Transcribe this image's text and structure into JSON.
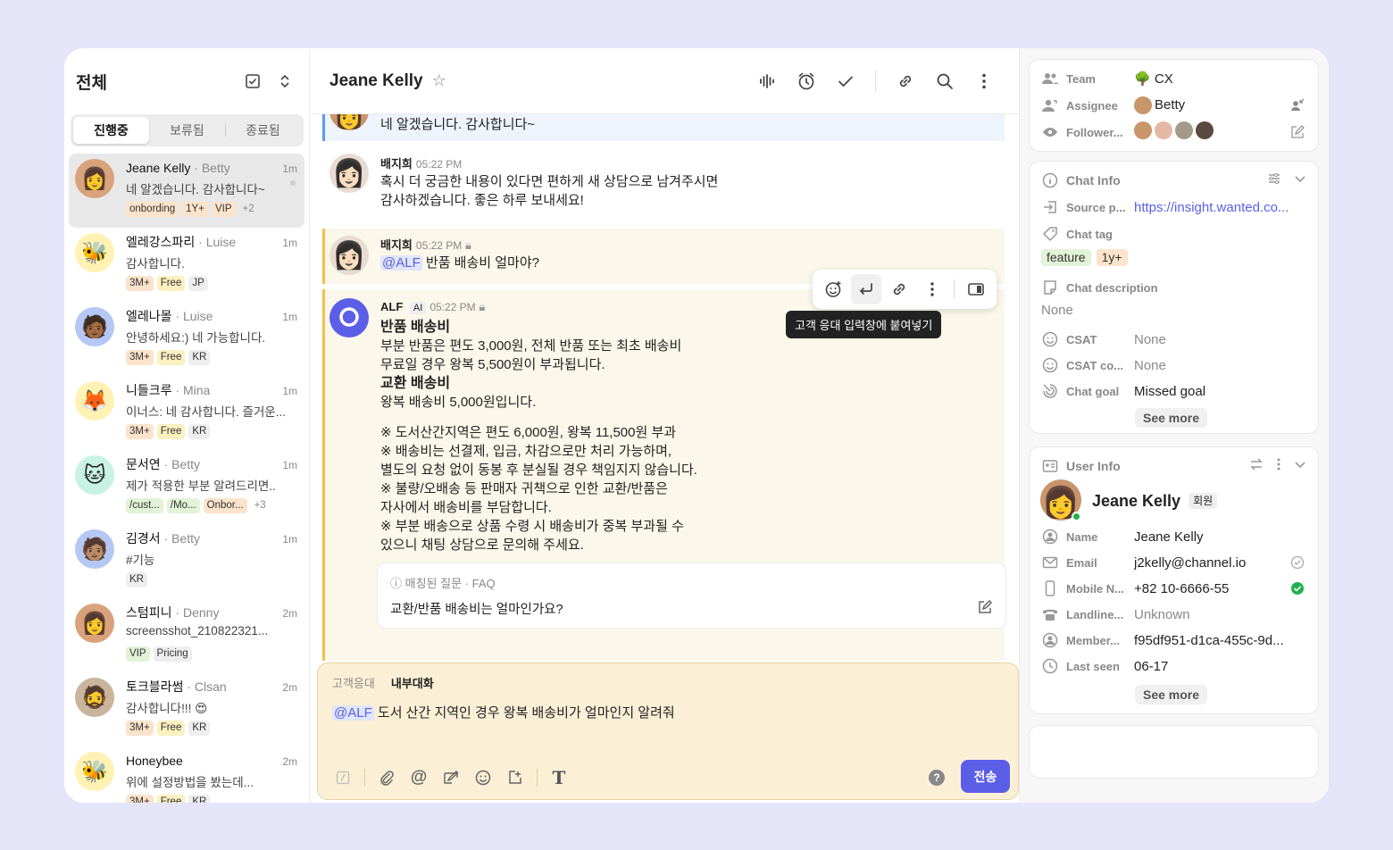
{
  "sidebar": {
    "title": "전체",
    "tabs": [
      "진행중",
      "보류됨",
      "종료됨"
    ],
    "chats": [
      {
        "name": "Jeane Kelly",
        "assignee": "· Betty",
        "time": "1m",
        "msg": "네 알겠습니다. 감사합니다~",
        "tags": [
          {
            "t": "onbording",
            "c": "o"
          },
          {
            "t": "1Y+",
            "c": "o"
          },
          {
            "t": "VIP",
            "c": "o"
          },
          {
            "t": "+2",
            "c": "more"
          }
        ],
        "avatar": "👩",
        "bg": "#d9a27a"
      },
      {
        "name": "엘레강스파리",
        "assignee": "· Luise",
        "time": "1m",
        "msg": "감사합니다.",
        "tags": [
          {
            "t": "3M+",
            "c": "o"
          },
          {
            "t": "Free",
            "c": "y"
          },
          {
            "t": "JP",
            "c": ""
          }
        ],
        "avatar": "🐝",
        "bg": "#fff2b3"
      },
      {
        "name": "엘레나몰",
        "assignee": "· Luise",
        "time": "1m",
        "msg": "안녕하세요:) 네 가능합니다.",
        "tags": [
          {
            "t": "3M+",
            "c": "o"
          },
          {
            "t": "Free",
            "c": "y"
          },
          {
            "t": "KR",
            "c": ""
          }
        ],
        "avatar": "🧑🏾",
        "bg": "#b5c7f5"
      },
      {
        "name": "니들크루",
        "assignee": "· Mina",
        "time": "1m",
        "msg": "이너스: 네 감사합니다. 즐거운...",
        "tags": [
          {
            "t": "3M+",
            "c": "o"
          },
          {
            "t": "Free",
            "c": "y"
          },
          {
            "t": "KR",
            "c": ""
          }
        ],
        "avatar": "🦊",
        "bg": "#fff2b3"
      },
      {
        "name": "문서연",
        "assignee": "· Betty",
        "time": "1m",
        "msg": "제가 적용한 부분 알려드리면..",
        "tags": [
          {
            "t": "/cust...",
            "c": "g"
          },
          {
            "t": "/Mo...",
            "c": "g"
          },
          {
            "t": "Onbor...",
            "c": "o"
          },
          {
            "t": "+3",
            "c": "more"
          }
        ],
        "avatar": "🐱",
        "bg": "#c8f2e4"
      },
      {
        "name": "김경서",
        "assignee": "· Betty",
        "time": "1m",
        "msg": "#기능",
        "tags": [
          {
            "t": "KR",
            "c": ""
          }
        ],
        "avatar": "🧑🏽",
        "bg": "#b5c7f5"
      },
      {
        "name": "스텀피니",
        "assignee": "· Denny",
        "time": "2m",
        "msg": "screensshot_210822321...",
        "tags": [
          {
            "t": "VIP",
            "c": "g"
          },
          {
            "t": "Pricing",
            "c": ""
          }
        ],
        "avatar": "👩",
        "bg": "#d9a27a"
      },
      {
        "name": "토크블라썸",
        "assignee": "· Clsan",
        "time": "2m",
        "msg": "감사합니다!!! 😍",
        "tags": [
          {
            "t": "3M+",
            "c": "o"
          },
          {
            "t": "Free",
            "c": "y"
          },
          {
            "t": "KR",
            "c": ""
          }
        ],
        "avatar": "🧔",
        "bg": "#c9b49c"
      },
      {
        "name": "Honeybee",
        "assignee": "",
        "time": "2m",
        "msg": "위에 설정방법을 봤는데...",
        "tags": [
          {
            "t": "3M+",
            "c": "o"
          },
          {
            "t": "Free",
            "c": "y"
          },
          {
            "t": "KR",
            "c": ""
          }
        ],
        "avatar": "🐝",
        "bg": "#fff2b3"
      }
    ]
  },
  "main": {
    "title": "Jeane Kelly",
    "top_text": "네 알겠습니다. 감사합니다~",
    "msg1": {
      "name": "배지희",
      "time": "05:22 PM",
      "line1": "혹시 더 궁금한 내용이 있다면 편하게 새 상담으로 남겨주시면",
      "line2": "감사하겠습니다. 좋은 하루 보내세요!"
    },
    "msg2": {
      "name": "배지희",
      "time": "05:22 PM",
      "mention": "@ALF",
      "text": " 반품 배송비 얼마야?"
    },
    "alf": {
      "name": "ALF",
      "badge": "AI",
      "time": "05:22 PM",
      "lines": [
        {
          "t": "반품 배송비",
          "b": true
        },
        {
          "t": "부분 반품은 편도 3,000원, 전체 반품 또는 최초 배송비",
          "b": false
        },
        {
          "t": "무료일 경우 왕복 5,500원이 부과됩니다.",
          "b": false
        },
        {
          "t": "교환 배송비",
          "b": true
        },
        {
          "t": "왕복 배송비 5,000원입니다.",
          "b": false
        },
        {
          "t": "",
          "b": false
        },
        {
          "t": "※ 도서산간지역은 편도 6,000원, 왕복 11,500원 부과",
          "b": false
        },
        {
          "t": "※ 배송비는 선결제, 입금, 차감으로만 처리 가능하며,",
          "b": false
        },
        {
          "t": "별도의 요청 없이 동봉 후 분실될 경우 책임지지 않습니다.",
          "b": false
        },
        {
          "t": "※ 불량/오배송 등 판매자 귀책으로 인한 교환/반품은",
          "b": false
        },
        {
          "t": "자사에서 배송비를 부담합니다.",
          "b": false
        },
        {
          "t": "※ 부분 배송으로 상품 수령 시 배송비가 중복 부과될 수",
          "b": false
        },
        {
          "t": "있으니 채팅 상담으로 문의해 주세요.",
          "b": false
        }
      ],
      "faq_label": "매칭된 질문 · FAQ",
      "faq_q": "교환/반품 배송비는 얼마인가요?"
    },
    "tooltip": "고객 응대 입력창에 붙여넣기",
    "composer": {
      "tab_inactive": "고객응대",
      "tab_active": "내부대화",
      "mention": "@ALF",
      "text": " 도서 산간 지역인 경우 왕복 배송비가 얼마인지 알려줘",
      "send": "전송",
      "help": "?"
    }
  },
  "right": {
    "team": {
      "label": "Team",
      "value": "CX"
    },
    "assignee": {
      "label": "Assignee",
      "value": "Betty"
    },
    "followers": {
      "label": "Follower..."
    },
    "chat_info": {
      "title": "Chat Info",
      "source_label": "Source p...",
      "source_value": "https://insight.wanted.co...",
      "tag_label": "Chat tag",
      "tags": [
        "feature",
        "1y+"
      ],
      "desc_label": "Chat description",
      "desc_value": "None",
      "csat_label": "CSAT",
      "csat_value": "None",
      "csatc_label": "CSAT co...",
      "csatc_value": "None",
      "goal_label": "Chat goal",
      "goal_value": "Missed goal",
      "see_more": "See more"
    },
    "user_info": {
      "title": "User Info",
      "name": "Jeane Kelly",
      "badge": "회원",
      "name_label": "Name",
      "name_value": "Jeane Kelly",
      "email_label": "Email",
      "email_value": "j2kelly@channel.io",
      "mobile_label": "Mobile N...",
      "mobile_value": "+82 10-6666-55",
      "landline_label": "Landline...",
      "landline_value": "Unknown",
      "member_label": "Member...",
      "member_value": "f95df951-d1ca-455c-9d...",
      "seen_label": "Last seen",
      "seen_value": "06-17",
      "see_more": "See more"
    }
  },
  "colors": {
    "accent": "#5b5fe8",
    "mention_bg": "#e1e5fb",
    "alf_bar": "#f2c04a",
    "highlight_bg": "#fbf7ea"
  }
}
